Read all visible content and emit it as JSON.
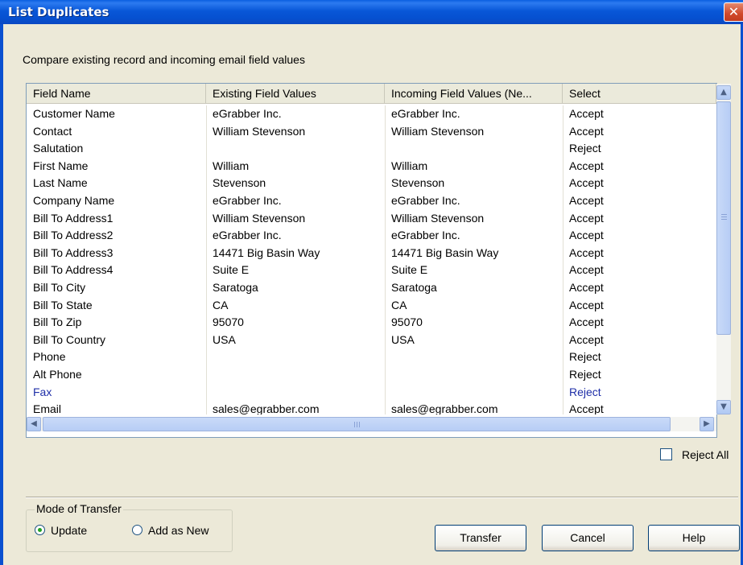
{
  "window": {
    "title": "List Duplicates",
    "close_glyph": "✕"
  },
  "subtitle": "Compare existing record and incoming email field values",
  "table": {
    "columns": [
      "Field Name",
      "Existing Field Values",
      "Incoming Field Values (Ne...",
      "Select"
    ],
    "rows": [
      [
        "Customer Name",
        "eGrabber Inc.",
        "eGrabber Inc.",
        "Accept"
      ],
      [
        "Contact",
        "William Stevenson",
        "William Stevenson",
        "Accept"
      ],
      [
        "Salutation",
        "",
        "",
        "Reject"
      ],
      [
        "First Name",
        "William",
        "William",
        "Accept"
      ],
      [
        "Last Name",
        "Stevenson",
        "Stevenson",
        "Accept"
      ],
      [
        "Company Name",
        "eGrabber Inc.",
        "eGrabber Inc.",
        "Accept"
      ],
      [
        "Bill To Address1",
        "William Stevenson",
        "William Stevenson",
        "Accept"
      ],
      [
        "Bill To Address2",
        "eGrabber Inc.",
        "eGrabber Inc.",
        "Accept"
      ],
      [
        "Bill To Address3",
        "14471 Big Basin Way",
        "14471 Big Basin Way",
        "Accept"
      ],
      [
        "Bill To Address4",
        "Suite E",
        "Suite E",
        "Accept"
      ],
      [
        "Bill To City",
        "Saratoga",
        "Saratoga",
        "Accept"
      ],
      [
        "Bill To State",
        "CA",
        "CA",
        "Accept"
      ],
      [
        "Bill To Zip",
        "95070",
        "95070",
        "Accept"
      ],
      [
        "Bill To Country",
        "USA",
        "USA",
        "Accept"
      ],
      [
        "Phone",
        "",
        "",
        "Reject"
      ],
      [
        "Alt Phone",
        "",
        "",
        "Reject"
      ],
      [
        "Fax",
        "",
        "",
        "Reject"
      ],
      [
        "Email",
        "sales@egrabber.com",
        "sales@egrabber.com",
        "Accept"
      ]
    ],
    "highlighted_row_color": "#1f2fa8"
  },
  "scrollbar": {
    "up_glyph": "▲",
    "down_glyph": "▼",
    "left_glyph": "◀",
    "right_glyph": "▶"
  },
  "reject_all": {
    "label": "Reject All",
    "checked": false
  },
  "mode_of_transfer": {
    "legend": "Mode of Transfer",
    "options": [
      {
        "label": "Update",
        "checked": true
      },
      {
        "label": "Add as New",
        "checked": false
      }
    ]
  },
  "buttons": {
    "transfer": "Transfer",
    "cancel": "Cancel",
    "help": "Help"
  },
  "colors": {
    "titlebar": "#0857d8",
    "dialog_bg": "#ece9d8",
    "grid_border": "#7f9db9"
  }
}
